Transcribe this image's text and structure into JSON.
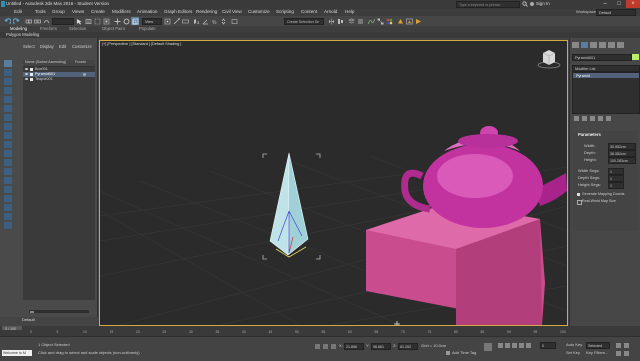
{
  "app": {
    "title": "Untitled - Autodesk 3ds Max 2016 - Student Version",
    "search_placeholder": "Type a keyword or phrase",
    "sign_in": "Sign In",
    "workspaces_label": "Workspaces:",
    "workspace_value": "Default"
  },
  "menus": [
    "Edit",
    "Tools",
    "Group",
    "Views",
    "Create",
    "Modifiers",
    "Animation",
    "Graph Editors",
    "Rendering",
    "Civil View",
    "Customize",
    "Scripting",
    "Content",
    "Arnold",
    "Help"
  ],
  "toolbar": {
    "reference_coord": "View",
    "selection_set_placeholder": "Create Selection Se"
  },
  "ribbon": {
    "tabs": [
      "Modeling",
      "Freeform",
      "Selection",
      "Object Paint",
      "Populate"
    ],
    "subtab": "Polygon Modeling"
  },
  "scene_explorer": {
    "tabs": [
      "Select",
      "Display",
      "Edit",
      "Customize"
    ],
    "column_header": "Name (Sorted Ascending)",
    "column_header2": "Frozen",
    "items": [
      "Box001",
      "Pyramid001",
      "Teapot001"
    ],
    "layer_label": "Default"
  },
  "viewport": {
    "label": "[+] [Perspective ] [Standard ] [Default Shading ]"
  },
  "command_panel": {
    "object_name": "Pyramid001",
    "modifier_list": "Modifier List",
    "stack_item": "Pyramid",
    "rollout_title": "Parameters",
    "params": [
      {
        "label": "Width:",
        "value": "30.952cm"
      },
      {
        "label": "Depth:",
        "value": "36.352cm"
      },
      {
        "label": "Height:",
        "value": "100.283cm"
      },
      {
        "label": "Width Segs:",
        "value": "1"
      },
      {
        "label": "Depth Segs:",
        "value": "1"
      },
      {
        "label": "Height Segs:",
        "value": "1"
      }
    ],
    "checkboxes": [
      "Generate Mapping Coords.",
      "Real-World Map Size"
    ]
  },
  "timeline": {
    "frame_counter": "0 / 100",
    "ticks": [
      "0",
      "5",
      "10",
      "15",
      "20",
      "25",
      "30",
      "35",
      "40",
      "45",
      "50",
      "55",
      "60",
      "65",
      "70",
      "75",
      "80",
      "85",
      "90",
      "95",
      "100"
    ]
  },
  "status": {
    "selection": "1 Object Selected",
    "prompt": "Click and drag to select and scale objects (non-uniformly)",
    "maxscript": "Welcome to M",
    "x_label": "X:",
    "x_value": "21.896",
    "y_label": "Y:",
    "y_value": "96.661",
    "z_label": "Z:",
    "z_value": "81.252",
    "grid": "Grid = 10.0cm",
    "autokey": "Auto Key",
    "setkey": "Set Key",
    "selected": "Selected",
    "key_filters": "Key Filters...",
    "add_time_tag": "Add Time Tag",
    "frame_value": "0"
  }
}
